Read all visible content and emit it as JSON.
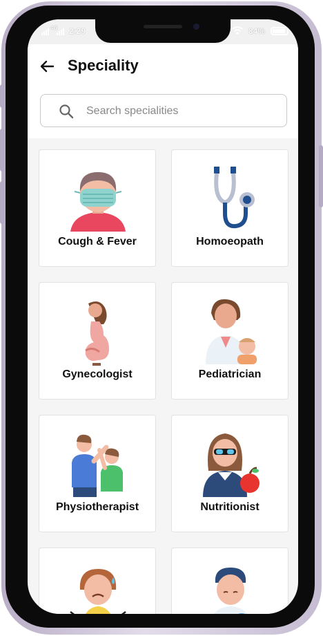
{
  "status_bar": {
    "time": "2:29",
    "signal": "4G",
    "battery": "84%"
  },
  "header": {
    "title": "Speciality"
  },
  "search": {
    "placeholder": "Search specialities",
    "value": ""
  },
  "specialities": [
    {
      "label": "Cough & Fever",
      "icon": "masked-person-icon"
    },
    {
      "label": "Homoeopath",
      "icon": "stethoscope-icon"
    },
    {
      "label": "Gynecologist",
      "icon": "pregnant-woman-icon"
    },
    {
      "label": "Pediatrician",
      "icon": "doctor-with-baby-icon"
    },
    {
      "label": "Physiotherapist",
      "icon": "physiotherapy-icon"
    },
    {
      "label": "Nutritionist",
      "icon": "nutritionist-with-apple-icon"
    },
    {
      "label": "",
      "icon": "anxious-person-icon"
    },
    {
      "label": "",
      "icon": "doctor-icon"
    }
  ]
}
